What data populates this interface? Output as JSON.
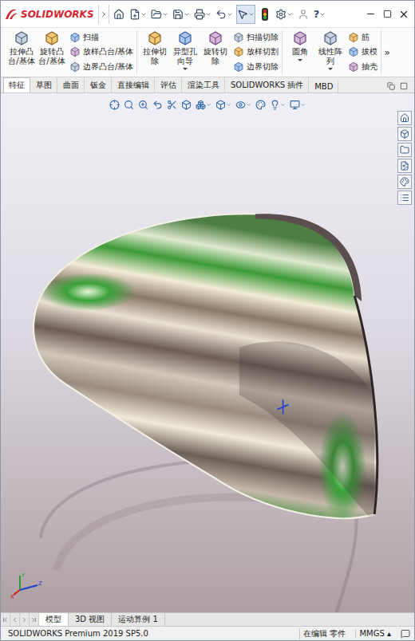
{
  "window": {
    "logo": "SOLIDWORKS",
    "help": "?"
  },
  "ribbon": {
    "groups": [
      {
        "large": [
          {
            "label": "拉伸凸台/基体",
            "dropdown": false
          },
          {
            "label": "旋转凸台/基体",
            "dropdown": false
          }
        ],
        "small": [
          "扫描",
          "放样凸台/基体",
          "边界凸台/基体"
        ]
      },
      {
        "large": [
          {
            "label": "拉伸切除",
            "dropdown": false
          },
          {
            "label": "异型孔向导",
            "dropdown": true
          },
          {
            "label": "旋转切除",
            "dropdown": false
          }
        ],
        "small": [
          "扫描切除",
          "放样切割",
          "边界切除"
        ]
      },
      {
        "large": [
          {
            "label": "圆角",
            "dropdown": true
          },
          {
            "label": "线性阵列",
            "dropdown": true
          }
        ],
        "small": [
          "筋",
          "拔模",
          "抽壳"
        ]
      }
    ],
    "more": "»"
  },
  "tabs": [
    {
      "label": "特征",
      "selected": true
    },
    {
      "label": "草图",
      "selected": false
    },
    {
      "label": "曲面",
      "selected": false
    },
    {
      "label": "钣金",
      "selected": false
    },
    {
      "label": "直接编辑",
      "selected": false
    },
    {
      "label": "评估",
      "selected": false
    },
    {
      "label": "渲染工具",
      "selected": false
    },
    {
      "label": "SOLIDWORKS 插件",
      "selected": false
    },
    {
      "label": "MBD",
      "selected": false
    }
  ],
  "triad": [
    "Y",
    "Z",
    "X"
  ],
  "model_tabs": [
    {
      "label": "模型",
      "selected": true
    },
    {
      "label": "3D 视图",
      "selected": false
    },
    {
      "label": "运动算例 1",
      "selected": false
    }
  ],
  "status_bar": {
    "product": "SOLIDWORKS Premium 2019 SP5.0",
    "mode": "在编辑 零件",
    "units": "MMGS",
    "units_arrow": "▴"
  }
}
